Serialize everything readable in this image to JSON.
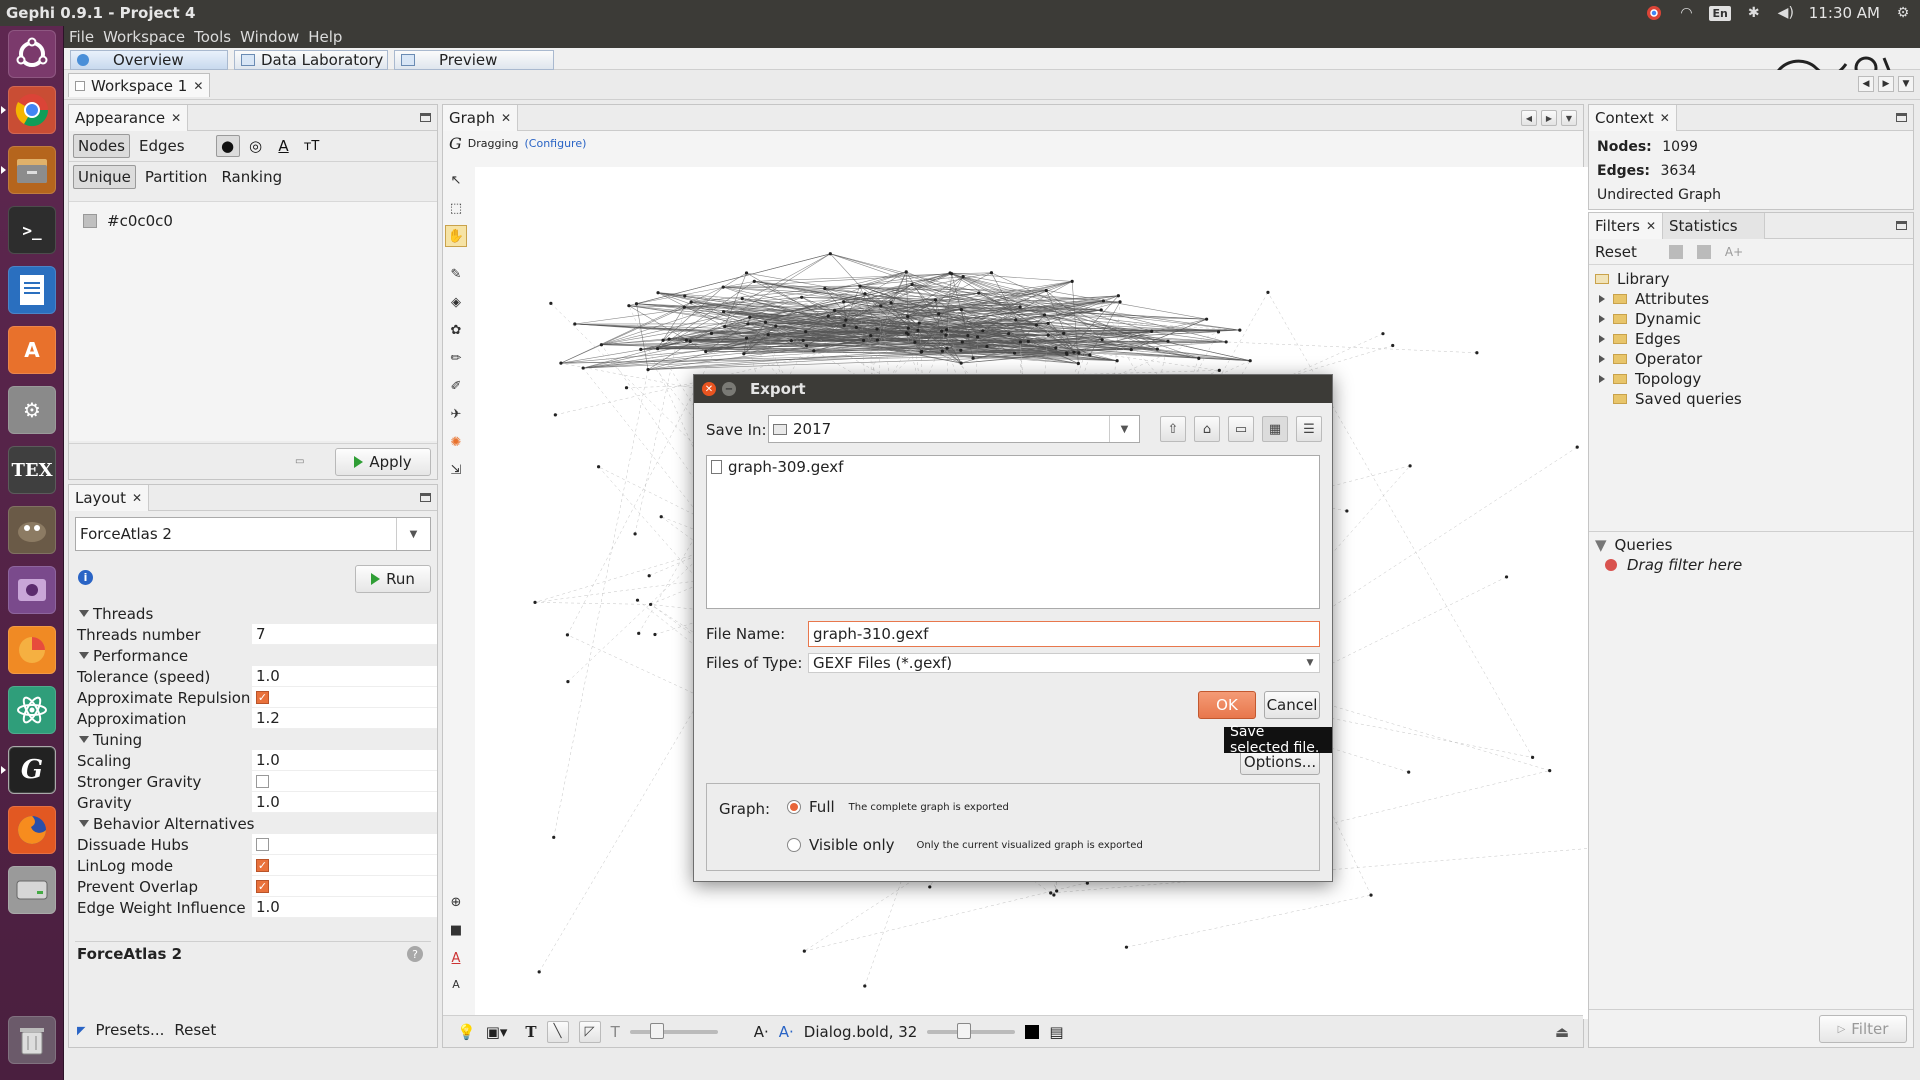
{
  "topbar": {
    "title": "Gephi 0.9.1 - Project 4",
    "lang": "En",
    "clock": "11:30 AM"
  },
  "launcher": {
    "items": [
      "ubuntu-dash",
      "chrome",
      "files",
      "terminal",
      "writer",
      "software-center",
      "system-settings",
      "texmaker",
      "gimp",
      "screencast",
      "mozilla",
      "atom",
      "gephi",
      "firefox",
      "disk-drive",
      "trash"
    ]
  },
  "menu": {
    "items": [
      "File",
      "Workspace",
      "Tools",
      "Window",
      "Help"
    ]
  },
  "perspectives": {
    "items": [
      "Overview",
      "Data Laboratory",
      "Preview"
    ]
  },
  "workspace": {
    "tab": "Workspace 1"
  },
  "appearance": {
    "title": "Appearance",
    "kinds": [
      "Nodes",
      "Edges"
    ],
    "modes": [
      "Unique",
      "Partition",
      "Ranking"
    ],
    "color_value": "#c0c0c0",
    "apply_label": "Apply"
  },
  "layout": {
    "title": "Layout",
    "algorithm": "ForceAtlas 2",
    "run_label": "Run",
    "groups": [
      {
        "name": "Threads",
        "rows": [
          {
            "key": "Threads number",
            "value": "7"
          }
        ]
      },
      {
        "name": "Performance",
        "rows": [
          {
            "key": "Tolerance (speed)",
            "value": "1.0"
          },
          {
            "key": "Approximate Repulsion",
            "check": true
          },
          {
            "key": "Approximation",
            "value": "1.2"
          }
        ]
      },
      {
        "name": "Tuning",
        "rows": [
          {
            "key": "Scaling",
            "value": "1.0"
          },
          {
            "key": "Stronger Gravity",
            "check": false
          },
          {
            "key": "Gravity",
            "value": "1.0"
          }
        ]
      },
      {
        "name": "Behavior Alternatives",
        "rows": [
          {
            "key": "Dissuade Hubs",
            "check": false
          },
          {
            "key": "LinLog mode",
            "check": true
          },
          {
            "key": "Prevent Overlap",
            "check": true
          },
          {
            "key": "Edge Weight Influence",
            "value": "1.0"
          }
        ]
      }
    ],
    "description_title": "ForceAtlas 2",
    "presets_label": "Presets...",
    "reset_label": "Reset"
  },
  "graph": {
    "title": "Graph",
    "mode_label": "Dragging",
    "configure_label": "(Configure)",
    "font_label": "Dialog.bold, 32"
  },
  "context": {
    "title": "Context",
    "nodes_label": "Nodes:",
    "nodes": "1099",
    "edges_label": "Edges:",
    "edges": "3634",
    "graph_type": "Undirected Graph"
  },
  "filters": {
    "tabs": [
      "Filters",
      "Statistics"
    ],
    "reset_label": "Reset",
    "library": "Library",
    "items": [
      "Attributes",
      "Dynamic",
      "Edges",
      "Operator",
      "Topology"
    ],
    "saved": "Saved queries",
    "queries_label": "Queries",
    "drag_hint": "Drag filter here",
    "filter_btn": "Filter"
  },
  "export_dialog": {
    "title": "Export",
    "save_in_label": "Save In:",
    "save_in_value": "2017",
    "files": [
      "graph-309.gexf"
    ],
    "file_name_label": "File Name:",
    "file_name_value": "graph-310.gexf",
    "files_of_type_label": "Files of Type:",
    "files_of_type_value": "GEXF Files (*.gexf)",
    "ok_label": "OK",
    "cancel_label": "Cancel",
    "tooltip": "Save selected file.",
    "options_label": "Options...",
    "graph_label": "Graph:",
    "full_label": "Full",
    "full_desc": "The complete graph is exported",
    "visible_label": "Visible only",
    "visible_desc": "Only the current visualized graph is exported",
    "selected": "Full"
  },
  "colors": {
    "accent": "#e8774c",
    "ubuntu_bar": "#3c3b37",
    "launcher": "#5e2750",
    "link": "#2a64c5"
  }
}
